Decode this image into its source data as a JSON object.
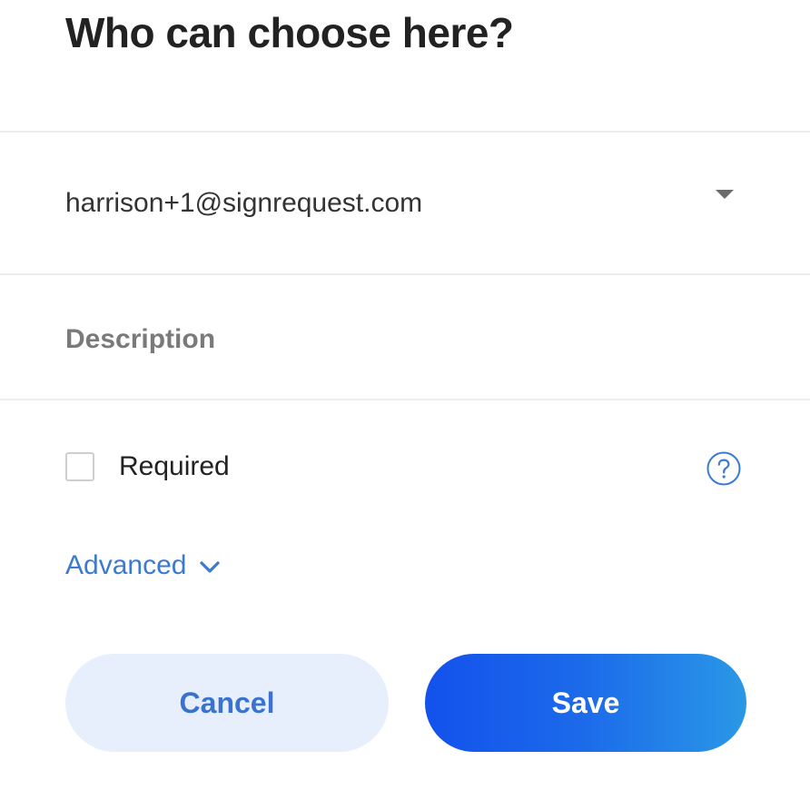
{
  "dialog": {
    "title": "Who can choose here?"
  },
  "signer_select": {
    "value": "harrison+1@signrequest.com",
    "icon": "caret-down-icon"
  },
  "description": {
    "value": "",
    "placeholder": "Description"
  },
  "required": {
    "label": "Required",
    "checked": false,
    "help_icon": "question-circle-icon"
  },
  "advanced": {
    "label": "Advanced",
    "icon": "chevron-down-icon"
  },
  "actions": {
    "cancel_label": "Cancel",
    "save_label": "Save"
  },
  "colors": {
    "accent": "#3b7ad1",
    "save_gradient_start": "#1351ec",
    "save_gradient_end": "#2a98e6",
    "cancel_bg": "#e8effc"
  }
}
